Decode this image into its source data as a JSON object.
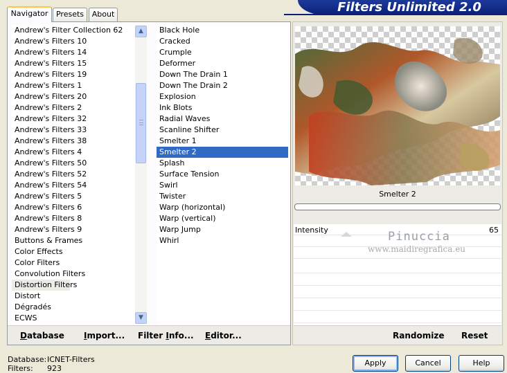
{
  "banner": {
    "title": "Filters Unlimited 2.0"
  },
  "tabs": [
    {
      "label": "Navigator"
    },
    {
      "label": "Presets"
    },
    {
      "label": "About"
    }
  ],
  "categories": [
    "Andrew's Filter Collection 62",
    "Andrew's Filters 10",
    "Andrew's Filters 14",
    "Andrew's Filters 15",
    "Andrew's Filters 19",
    "Andrew's Filters 1",
    "Andrew's Filters 20",
    "Andrew's Filters 2",
    "Andrew's Filters 32",
    "Andrew's Filters 33",
    "Andrew's Filters 38",
    "Andrew's Filters 4",
    "Andrew's Filters 50",
    "Andrew's Filters 52",
    "Andrew's Filters 54",
    "Andrew's Filters 5",
    "Andrew's Filters 6",
    "Andrew's Filters 8",
    "Andrew's Filters 9",
    "Buttons & Frames",
    "Color Effects",
    "Color Filters",
    "Convolution Filters",
    "Distortion Filters",
    "Distort",
    "Dégradés",
    "ECWS"
  ],
  "selected_category": "Distortion Filters",
  "filters": [
    "Black Hole",
    "Cracked",
    "Crumple",
    "Deformer",
    "Down The Drain 1",
    "Down The Drain 2",
    "Explosion",
    "Ink Blots",
    "Radial Waves",
    "Scanline Shifter",
    "Smelter 1",
    "Smelter 2",
    "Splash",
    "Surface Tension",
    "Swirl",
    "Twister",
    "Warp (horizontal)",
    "Warp (vertical)",
    "Warp Jump",
    "Whirl"
  ],
  "selected_filter": "Smelter 2",
  "nav_buttons": {
    "database": {
      "underlined": "D",
      "rest": "atabase"
    },
    "import": {
      "underlined": "I",
      "rest": "mport..."
    },
    "filter_info": {
      "prefix": "Filter ",
      "underlined": "I",
      "rest": "nfo..."
    },
    "editor": {
      "underlined": "E",
      "rest": "ditor..."
    }
  },
  "preview": {
    "filter_name": "Smelter 2"
  },
  "parameter": {
    "label": "Intensity",
    "value": "65"
  },
  "watermark": {
    "name": "Pinuccia",
    "url": "www.maidiregrafica.eu"
  },
  "right_buttons": {
    "randomize": "Randomize",
    "reset": "Reset"
  },
  "status": {
    "database_label": "Database:",
    "database_value": "ICNET-Filters",
    "filters_label": "Filters:",
    "filters_value": "923"
  },
  "dialog_buttons": {
    "apply": "Apply",
    "cancel": "Cancel",
    "help": "Help"
  },
  "colors": {
    "banner": "#0a1f78",
    "selection": "#316ac5",
    "dialog_bg": "#ece9d8"
  },
  "icons": {
    "scroll_up": "chevron-up-icon",
    "scroll_down": "chevron-down-icon"
  }
}
